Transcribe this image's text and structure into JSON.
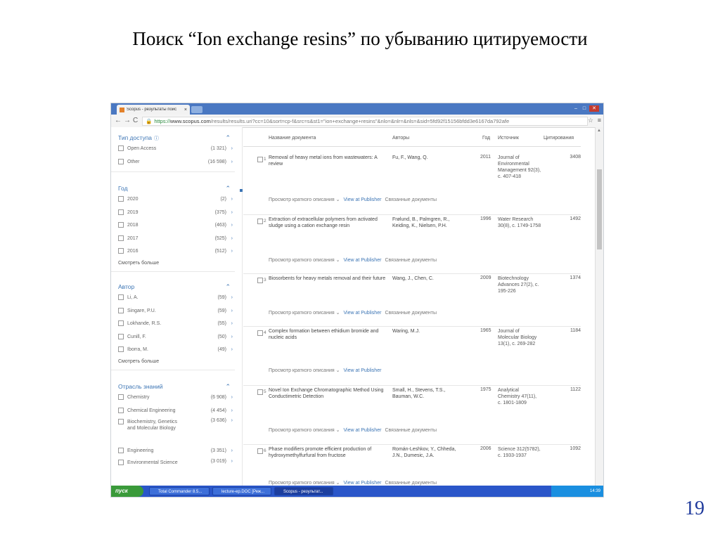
{
  "slide": {
    "title": "Поиск “Ion exchange resins” по убыванию цитируемости",
    "page_number": "19"
  },
  "browser": {
    "tab_title": "Scopus - результаты поис",
    "tab_close": "×",
    "url_scheme": "https://",
    "url_host": "www.scopus.com",
    "url_path": "/results/results.uri?cc=10&sort=cp-f&src=s&st1=\"ion+exchange+resins\"&nlo=&nlr=&nls=&sid=5fd92f15156bfdd3e6167da792afe",
    "nav_back": "←",
    "nav_forward": "→",
    "nav_reload": "C"
  },
  "facets": [
    {
      "title": "Тип доступа",
      "items": [
        {
          "label": "Open Access",
          "count": "(1 321)"
        },
        {
          "label": "Other",
          "count": "(16 598)"
        }
      ]
    },
    {
      "title": "Год",
      "items": [
        {
          "label": "2020",
          "count": "(2)"
        },
        {
          "label": "2019",
          "count": "(375)"
        },
        {
          "label": "2018",
          "count": "(463)"
        },
        {
          "label": "2017",
          "count": "(525)"
        },
        {
          "label": "2016",
          "count": "(512)"
        }
      ],
      "more": "Смотреть больше"
    },
    {
      "title": "Автор",
      "items": [
        {
          "label": "Li, A.",
          "count": "(59)"
        },
        {
          "label": "Singare, P.U.",
          "count": "(59)"
        },
        {
          "label": "Lokhande, R.S.",
          "count": "(55)"
        },
        {
          "label": "Cunill, F.",
          "count": "(50)"
        },
        {
          "label": "Iborra, M.",
          "count": "(49)"
        }
      ],
      "more": "Смотреть больше"
    },
    {
      "title": "Отрасль знаний",
      "items": [
        {
          "label": "Chemistry",
          "count": "(6 908)"
        },
        {
          "label": "Chemical Engineering",
          "count": "(4 454)"
        },
        {
          "label": "Biochemistry, Genetics and Molecular Biology",
          "count": "(3 636)"
        },
        {
          "label": "Engineering",
          "count": "(3 351)"
        },
        {
          "label": "Environmental Science",
          "count": "(3 019)"
        }
      ]
    }
  ],
  "results_header": {
    "title": "Название документа",
    "authors": "Авторы",
    "year": "Год",
    "source": "Источник",
    "cited": "Цитирования"
  },
  "result_links": {
    "abstract": "Просмотр краткого описания",
    "publisher": "View at Publisher",
    "related": "Связанные документы"
  },
  "results": [
    {
      "n": "1",
      "title": "Removal of heavy metal ions from wastewaters: A review",
      "authors": "Fu, F., Wang, Q.",
      "year": "2011",
      "source": "Journal of Environmental Management 92(3), c. 407-418",
      "cited": "3408"
    },
    {
      "n": "2",
      "title": "Extraction of extracellular polymers from activated sludge using a cation exchange resin",
      "authors": "Frølund, B., Palmgren, R., Keiding, K., Nielsen, P.H.",
      "year": "1996",
      "source": "Water Research 30(8), c. 1749-1758",
      "cited": "1492"
    },
    {
      "n": "3",
      "title": "Biosorbents for heavy metals removal and their future",
      "authors": "Wang, J., Chen, C.",
      "year": "2009",
      "source": "Biotechnology Advances 27(2), c. 195-226",
      "cited": "1374"
    },
    {
      "n": "4",
      "title": "Complex formation between ethidium bromide and nucleic acids",
      "authors": "Waring, M.J.",
      "year": "1965",
      "source": "Journal of Molecular Biology 13(1), c. 269-282",
      "cited": "1184"
    },
    {
      "n": "5",
      "title": "Novel Ion Exchange Chromatographic Method Using Conductimetric Detection",
      "authors": "Small, H., Stevens, T.S., Bauman, W.C.",
      "year": "1975",
      "source": "Analytical Chemistry 47(11), c. 1801-1809",
      "cited": "1122"
    },
    {
      "n": "6",
      "title": "Phase modifiers promote efficient production of hydroxymethylfurfural from fructose",
      "authors": "Román-Leshkov, Y., Chheda, J.N., Dumesic, J.A.",
      "year": "2006",
      "source": "Science 312(5782), c. 1933-1937",
      "cited": "1092"
    }
  ],
  "taskbar": {
    "start": "пуск",
    "items": [
      "Total Commander 8.5...",
      "lecture-ep.DOC [Реж...",
      "Scopus - результат..."
    ],
    "clock": "14:39"
  }
}
